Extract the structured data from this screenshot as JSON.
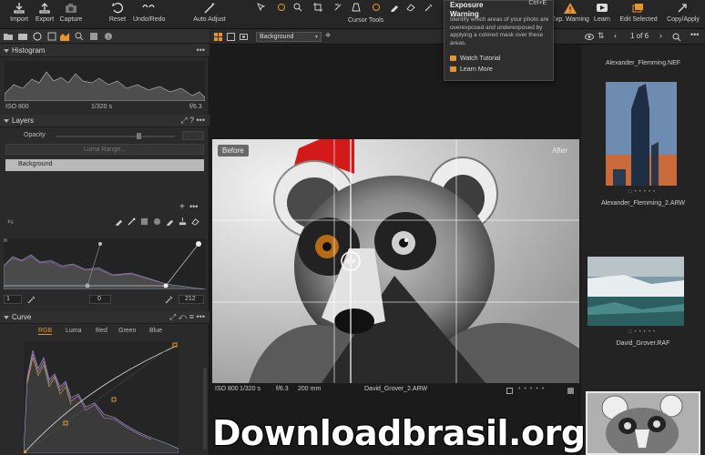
{
  "toolbar": {
    "import": "Import",
    "export": "Export",
    "capture": "Capture",
    "reset": "Reset",
    "undo_redo": "Undo/Redo",
    "auto_adjust": "Auto Adjust",
    "cursor_tools": "Cursor Tools",
    "exp_warning": "Exp. Warning",
    "learn": "Learn",
    "edit_selected": "Edit Selected",
    "copy_apply": "Copy/Apply"
  },
  "tooltip": {
    "title": "Exposure Warning",
    "shortcut": "Ctrl+E",
    "description": "Identify which areas of your photo are overexposed and underexposed by applying a colored mask over these areas.",
    "watch_tutorial": "Watch Tutorial",
    "learn_more": "Learn More"
  },
  "left": {
    "histogram": {
      "title": "Histogram",
      "iso": "ISO 800",
      "shutter": "1/320 s",
      "aperture": "f/6.3"
    },
    "layers": {
      "title": "Layers",
      "opacity_label": "Opacity",
      "luma_range": "Luma Range...",
      "background_layer": "Background"
    },
    "levels": {
      "low": "1",
      "mid": "0",
      "high": "212"
    },
    "curve": {
      "title": "Curve",
      "tabs": [
        "RGB",
        "Luma",
        "Red",
        "Green",
        "Blue"
      ],
      "active_tab": "RGB"
    }
  },
  "viewer": {
    "variant": "Background",
    "before": "Before",
    "after": "After",
    "info": {
      "iso": "ISO 800",
      "shutter": "1/320 s",
      "aperture": "f/6.3",
      "focal": "200 mm",
      "filename": "David_Grover_2.ARW"
    }
  },
  "browser": {
    "counter": "1 of 6",
    "thumbs": [
      "Alexander_Flemming.NEF",
      "Alexander_Flemming_2.ARW",
      "David_Grover.RAF"
    ]
  },
  "watermark": "Downloadbrasil.org",
  "colors": {
    "accent": "#e8952f",
    "warning_red": "#d21a1a",
    "panel_bg": "#2a2a2a"
  }
}
